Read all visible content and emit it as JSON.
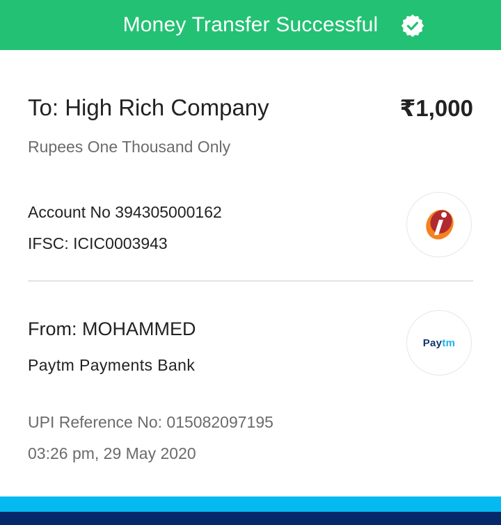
{
  "header": {
    "title": "Money Transfer Successful",
    "icon": "verified-badge-icon",
    "color": "#23c173"
  },
  "recipient": {
    "to_label": "To: High Rich Company",
    "amount": "₹1,000",
    "amount_in_words": "Rupees One Thousand  Only",
    "account_no": "Account No 394305000162",
    "ifsc": "IFSC: ICIC0003943",
    "bank_logo": "icici-bank-logo"
  },
  "sender": {
    "from_label": "From: MOHAMMED",
    "bank": "Paytm Payments Bank",
    "bank_logo_text_pay": "Pay",
    "bank_logo_text_tm": "tm"
  },
  "transaction": {
    "upi_reference": "UPI Reference No: 015082097195",
    "timestamp": "03:26 pm, 29 May 2020"
  },
  "colors": {
    "strip_light": "#05b9f1",
    "strip_dark": "#05296b"
  }
}
